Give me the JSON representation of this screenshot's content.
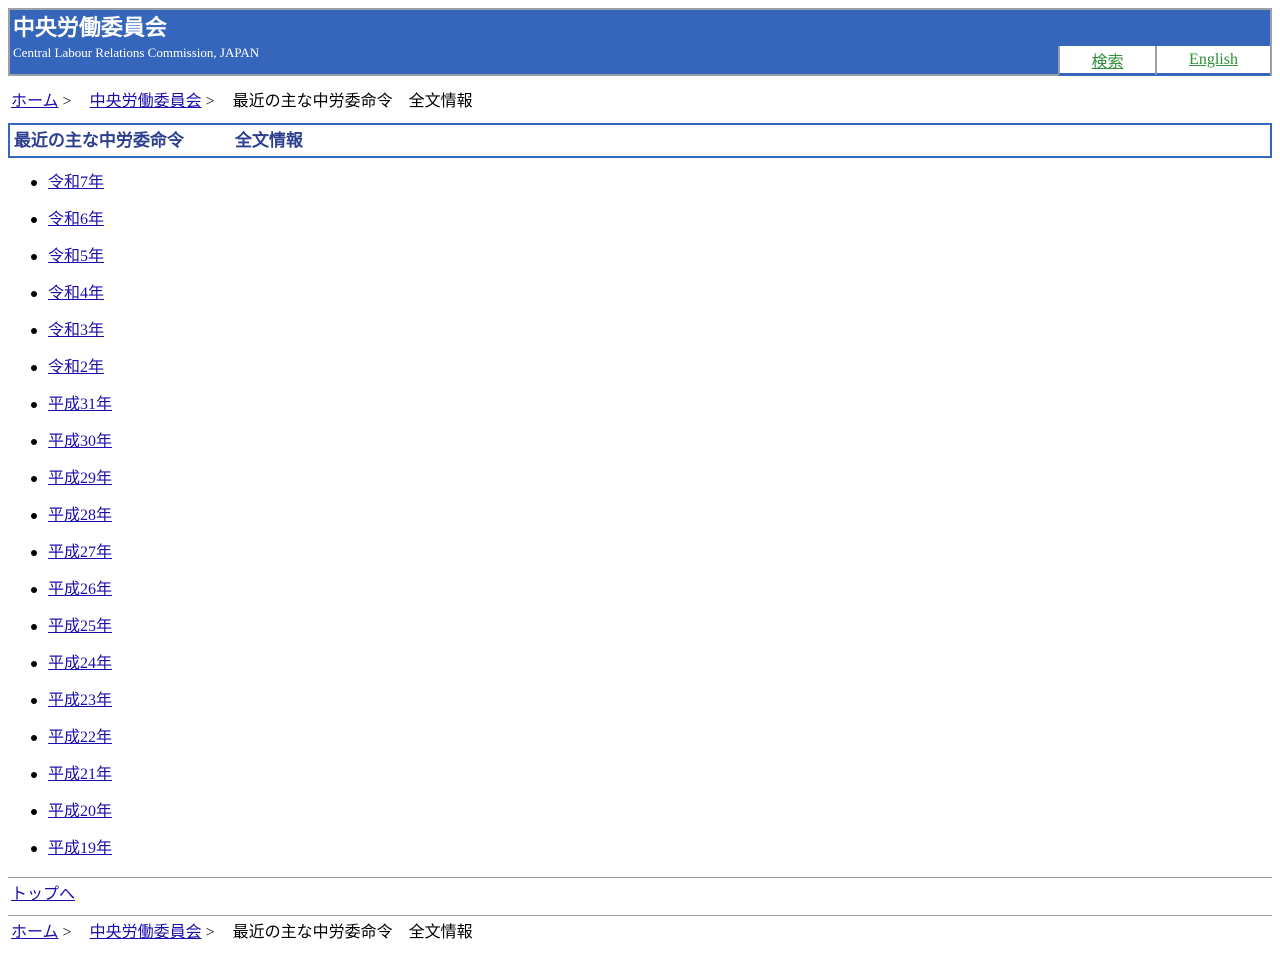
{
  "header": {
    "title": "中央労働委員会",
    "subtitle": "Central Labour Relations Commission, JAPAN",
    "tabs": {
      "search": "検索",
      "english": "English"
    },
    "colors": {
      "background": "#3566bb",
      "tab_link": "#2f8f3a"
    }
  },
  "breadcrumb": {
    "home": "ホーム",
    "separator": ">",
    "commission": "中央労働委員会",
    "current": "最近の主な中労委命令　全文情報"
  },
  "page": {
    "title": "最近の主な中労委命令　　　全文情報"
  },
  "years": [
    "令和7年",
    "令和6年",
    "令和5年",
    "令和4年",
    "令和3年",
    "令和2年",
    "平成31年",
    "平成30年",
    "平成29年",
    "平成28年",
    "平成27年",
    "平成26年",
    "平成25年",
    "平成24年",
    "平成23年",
    "平成22年",
    "平成21年",
    "平成20年",
    "平成19年"
  ],
  "footer": {
    "to_top": "トップへ"
  }
}
